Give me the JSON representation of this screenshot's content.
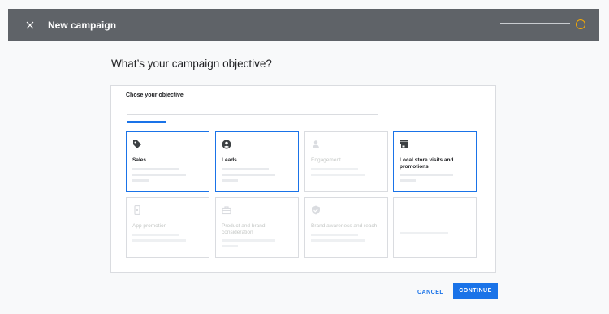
{
  "topbar": {
    "title": "New campaign",
    "progress_accent": "#f9ab00"
  },
  "main": {
    "heading": "What’s your campaign objective?"
  },
  "card": {
    "header_label": "Chose your objective"
  },
  "objectives": [
    {
      "label": "Sales",
      "icon": "tag-icon",
      "selected": true
    },
    {
      "label": "Leads",
      "icon": "account-circle-icon",
      "selected": true
    },
    {
      "label": "Engagement",
      "icon": "person-icon",
      "selected": false
    },
    {
      "label": "Local store visits and promotions",
      "icon": "store-icon",
      "selected": true
    },
    {
      "label": "App promotion",
      "icon": "phone-icon",
      "selected": false
    },
    {
      "label": "Product and brand consideration",
      "icon": "shopping-bag-icon",
      "selected": false
    },
    {
      "label": "Brand awareness and reach",
      "icon": "verified-shield-icon",
      "selected": false
    },
    {
      "label": "",
      "icon": "",
      "selected": false
    }
  ],
  "actions": {
    "cancel_label": "CANCEL",
    "continue_label": "CONTINUE"
  },
  "colors": {
    "accent": "#1a73e8",
    "topbar": "#5f6368"
  }
}
